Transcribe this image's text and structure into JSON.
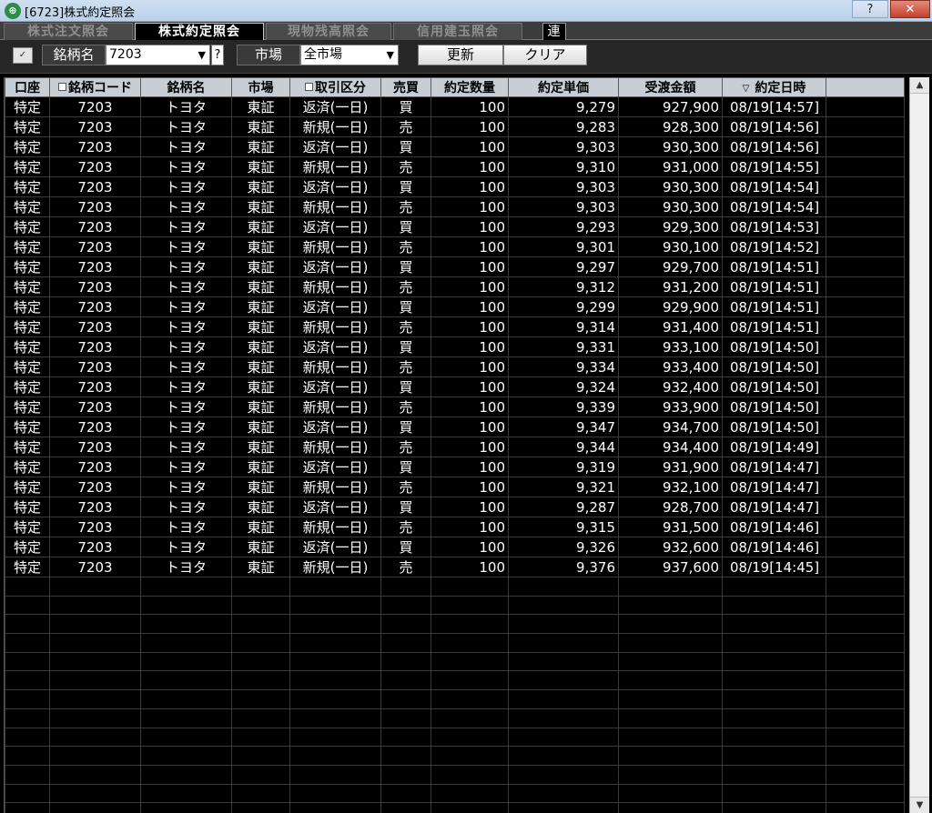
{
  "window": {
    "title": "[6723]株式約定照会",
    "icon": "app-logo-icon",
    "help": "?",
    "close": "✕"
  },
  "tabs": [
    {
      "label": "株式注文照会"
    },
    {
      "label": "株式約定照会"
    },
    {
      "label": "現物残高照会"
    },
    {
      "label": "信用建玉照会"
    },
    {
      "label": "連"
    }
  ],
  "toolbar": {
    "check": "✓",
    "symbol_label": "銘柄名",
    "symbol_value": "7203",
    "question": "?",
    "market_label": "市場",
    "market_value": "全市場",
    "refresh": "更新",
    "clear": "クリア"
  },
  "table": {
    "columns": [
      "口座",
      "銘柄コード",
      "銘柄名",
      "市場",
      "取引区分",
      "売買",
      "約定数量",
      "約定単価",
      "受渡金額",
      "約定日時"
    ],
    "rows": [
      [
        "特定",
        "7203",
        "トヨタ",
        "東証",
        "返済(一日)",
        "買",
        "100",
        "9,279",
        "927,900",
        "08/19[14:57]"
      ],
      [
        "特定",
        "7203",
        "トヨタ",
        "東証",
        "新規(一日)",
        "売",
        "100",
        "9,283",
        "928,300",
        "08/19[14:56]"
      ],
      [
        "特定",
        "7203",
        "トヨタ",
        "東証",
        "返済(一日)",
        "買",
        "100",
        "9,303",
        "930,300",
        "08/19[14:56]"
      ],
      [
        "特定",
        "7203",
        "トヨタ",
        "東証",
        "新規(一日)",
        "売",
        "100",
        "9,310",
        "931,000",
        "08/19[14:55]"
      ],
      [
        "特定",
        "7203",
        "トヨタ",
        "東証",
        "返済(一日)",
        "買",
        "100",
        "9,303",
        "930,300",
        "08/19[14:54]"
      ],
      [
        "特定",
        "7203",
        "トヨタ",
        "東証",
        "新規(一日)",
        "売",
        "100",
        "9,303",
        "930,300",
        "08/19[14:54]"
      ],
      [
        "特定",
        "7203",
        "トヨタ",
        "東証",
        "返済(一日)",
        "買",
        "100",
        "9,293",
        "929,300",
        "08/19[14:53]"
      ],
      [
        "特定",
        "7203",
        "トヨタ",
        "東証",
        "新規(一日)",
        "売",
        "100",
        "9,301",
        "930,100",
        "08/19[14:52]"
      ],
      [
        "特定",
        "7203",
        "トヨタ",
        "東証",
        "返済(一日)",
        "買",
        "100",
        "9,297",
        "929,700",
        "08/19[14:51]"
      ],
      [
        "特定",
        "7203",
        "トヨタ",
        "東証",
        "新規(一日)",
        "売",
        "100",
        "9,312",
        "931,200",
        "08/19[14:51]"
      ],
      [
        "特定",
        "7203",
        "トヨタ",
        "東証",
        "返済(一日)",
        "買",
        "100",
        "9,299",
        "929,900",
        "08/19[14:51]"
      ],
      [
        "特定",
        "7203",
        "トヨタ",
        "東証",
        "新規(一日)",
        "売",
        "100",
        "9,314",
        "931,400",
        "08/19[14:51]"
      ],
      [
        "特定",
        "7203",
        "トヨタ",
        "東証",
        "返済(一日)",
        "買",
        "100",
        "9,331",
        "933,100",
        "08/19[14:50]"
      ],
      [
        "特定",
        "7203",
        "トヨタ",
        "東証",
        "新規(一日)",
        "売",
        "100",
        "9,334",
        "933,400",
        "08/19[14:50]"
      ],
      [
        "特定",
        "7203",
        "トヨタ",
        "東証",
        "返済(一日)",
        "買",
        "100",
        "9,324",
        "932,400",
        "08/19[14:50]"
      ],
      [
        "特定",
        "7203",
        "トヨタ",
        "東証",
        "新規(一日)",
        "売",
        "100",
        "9,339",
        "933,900",
        "08/19[14:50]"
      ],
      [
        "特定",
        "7203",
        "トヨタ",
        "東証",
        "返済(一日)",
        "買",
        "100",
        "9,347",
        "934,700",
        "08/19[14:50]"
      ],
      [
        "特定",
        "7203",
        "トヨタ",
        "東証",
        "新規(一日)",
        "売",
        "100",
        "9,344",
        "934,400",
        "08/19[14:49]"
      ],
      [
        "特定",
        "7203",
        "トヨタ",
        "東証",
        "返済(一日)",
        "買",
        "100",
        "9,319",
        "931,900",
        "08/19[14:47]"
      ],
      [
        "特定",
        "7203",
        "トヨタ",
        "東証",
        "新規(一日)",
        "売",
        "100",
        "9,321",
        "932,100",
        "08/19[14:47]"
      ],
      [
        "特定",
        "7203",
        "トヨタ",
        "東証",
        "返済(一日)",
        "買",
        "100",
        "9,287",
        "928,700",
        "08/19[14:47]"
      ],
      [
        "特定",
        "7203",
        "トヨタ",
        "東証",
        "新規(一日)",
        "売",
        "100",
        "9,315",
        "931,500",
        "08/19[14:46]"
      ],
      [
        "特定",
        "7203",
        "トヨタ",
        "東証",
        "返済(一日)",
        "買",
        "100",
        "9,326",
        "932,600",
        "08/19[14:46]"
      ],
      [
        "特定",
        "7203",
        "トヨタ",
        "東証",
        "新規(一日)",
        "売",
        "100",
        "9,376",
        "937,600",
        "08/19[14:45]"
      ]
    ]
  },
  "scrollbar": {
    "up_icon": "scroll-up-arrow-icon",
    "down_icon": "scroll-down-arrow-icon"
  }
}
